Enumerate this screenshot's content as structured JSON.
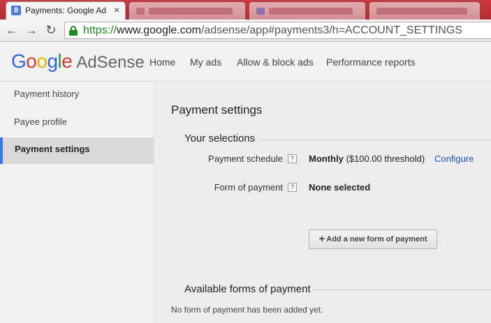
{
  "browser": {
    "tab_title": "Payments: Google Ad",
    "tab_icon": "adsense-favicon",
    "tab_close": "×",
    "url_scheme": "https://",
    "url_host": "www.google.com",
    "url_path": "/adsense/app#payments3/h=ACCOUNT_SETTINGS",
    "back_glyph": "←",
    "forward_glyph": "→",
    "reload_glyph": "↻"
  },
  "header": {
    "logo_word": "Google",
    "product": "AdSense",
    "nav": [
      "Home",
      "My ads",
      "Allow & block ads",
      "Performance reports"
    ]
  },
  "sidebar": {
    "items": [
      {
        "label": "Payment history"
      },
      {
        "label": "Payee profile"
      },
      {
        "label": "Payment settings",
        "active": true
      }
    ]
  },
  "main": {
    "title": "Payment settings",
    "selections_header": "Your selections",
    "rows": [
      {
        "label": "Payment schedule",
        "value_strong": "Monthly",
        "value_rest": " ($100.00 threshold)",
        "link": "Configure"
      },
      {
        "label": "Form of payment",
        "value": "None selected"
      }
    ],
    "help_glyph": "?",
    "add_button": "Add a new form of payment",
    "available_header": "Available forms of payment",
    "empty_message": "No form of payment has been added yet."
  },
  "colors": {
    "tabstrip": "#b42d33",
    "active_nav_accent": "#3b78e7",
    "link": "#1a55b8",
    "secure_green": "#1e8a1e"
  }
}
